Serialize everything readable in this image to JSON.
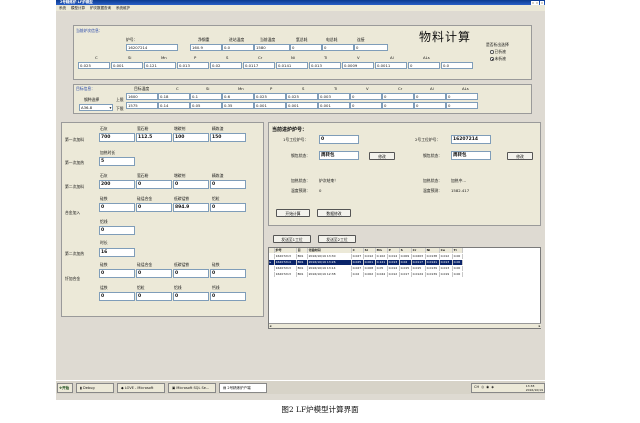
{
  "window": {
    "title": "2号精炼炉 LF炉模型",
    "menu": [
      "系统",
      "模型计算",
      "炉次数据查询",
      "系统维护"
    ]
  },
  "current": {
    "group_title": "当前炉次信息：",
    "heat_label": "炉号：",
    "heat_value": "16207214",
    "cols": [
      "净钢重",
      "进站温度",
      "当前温度",
      "氩总耗",
      "电总耗",
      "连接"
    ],
    "vals": [
      "160.9",
      "0.0",
      "1580",
      "0",
      "0",
      "0"
    ],
    "chem_labels": [
      "C",
      "Si",
      "Mn",
      "P",
      "S",
      "Cr",
      "Ni",
      "Ti",
      "V",
      "Al",
      "ALs"
    ],
    "chem_vals": [
      "0.025",
      "0.001",
      "0.121",
      "0.013",
      "0.02",
      "0.0117",
      "0.0141",
      "0.013",
      "0.0009",
      "0.0011",
      "0",
      "0.0"
    ]
  },
  "big_title": "物料计算",
  "alloyed": {
    "question": "是否析出选择",
    "options": [
      "已析液",
      "未析液"
    ],
    "selected": 1
  },
  "target": {
    "group_title": "目标信息：",
    "grade_label": "钢种选择",
    "grade_value": "A36-8",
    "upper_label": "上限",
    "lower_label": "下限",
    "headers": [
      "目标温度",
      "C",
      "Si",
      "Mn",
      "P",
      "S",
      "Ti",
      "V",
      "Cr",
      "Al",
      "ALs"
    ],
    "upper": [
      "1600",
      "0.18",
      "0.1",
      "0.6",
      "0.025",
      "0.025",
      "0.003",
      "0",
      "0",
      "0",
      "0"
    ],
    "lower": [
      "1575",
      "0.14",
      "0.05",
      "0.35",
      "0.001",
      "0.001",
      "0.001",
      "0",
      "0",
      "0",
      "0"
    ]
  },
  "additions": {
    "first_label": "第一次加料",
    "first_headers": [
      "石灰",
      "萤石粉",
      "增碳剂",
      "精炼渣"
    ],
    "first_vals": [
      "700",
      "112.5",
      "100",
      "150"
    ],
    "time_label": "加热时长",
    "first_time_label": "第一次加热",
    "first_time_val": "5",
    "second_label": "第二次加料",
    "second_headers": [
      "石灰",
      "萤石粉",
      "增碳剂",
      "精炼渣"
    ],
    "second_vals": [
      "200",
      "0",
      "0",
      "0"
    ],
    "alloy_label": "合金加入",
    "alloy_headers": [
      "硅铁",
      "硅锰合金",
      "低碳锰铁",
      "铝粒"
    ],
    "alloy_vals": [
      "0",
      "0",
      "894.9",
      "0"
    ],
    "wire_label": "铝线",
    "wire_val": "0",
    "second_time_header": "时长",
    "second_time_label": "第二次加热",
    "second_time_val": "16",
    "fine_label": "钎加合金",
    "fine_headers": [
      "硅铁",
      "硅锰合金",
      "低碳锰铁",
      "硅铁"
    ],
    "fine_vals": [
      "0",
      "0",
      "0",
      "0"
    ],
    "fine_headers2": [
      "锰铁",
      "铝粒",
      "铝线",
      "钙线"
    ],
    "fine_vals2": [
      "0",
      "0",
      "0",
      "0"
    ]
  },
  "station": {
    "title": "当前进炉炉号：",
    "s1_label": "1号工位炉号：",
    "s1_val": "0",
    "s2_label": "2号工位炉号：",
    "s2_val": "16207214",
    "state_label": "钢包状态：",
    "s1_state": "周转包",
    "s2_state": "周转包",
    "edit": "修改",
    "heat1_label": "加热状态：",
    "heat1_val": "炉次结束！",
    "heat2_label": "加热状态：",
    "heat2_val": "加热中...",
    "temp1_label": "温度预测：",
    "temp1_val": "0",
    "temp2_label": "温度预测：",
    "temp2_val": "1582.417",
    "start_btn": "开始计算",
    "data_btn": "数据修改",
    "send1": "发送至1工位",
    "send2": "发送至2工位"
  },
  "table": {
    "headers": [
      "",
      "炉号",
      "目",
      "化验时间",
      "C",
      "Si",
      "Mn",
      "P",
      "S",
      "Cr",
      "Ni",
      "Cu",
      "Ti"
    ],
    "rows": [
      [
        "",
        "16207213",
        "B01",
        "2016/10/19 13:30",
        "0.027",
        "0.012",
        "0.102",
        "0.014",
        "0.009",
        "0.0203",
        "0.0138",
        "0.012",
        "0.00"
      ],
      [
        "▸",
        "16207214",
        "B01",
        "2016/10/19 13:26",
        "0.025",
        "0.001",
        "0.121",
        "0.013",
        "0.02",
        "0.0117",
        "0.0141",
        "0.013",
        "0.00"
      ],
      [
        "",
        "16207213",
        "B01",
        "2016/10/19 13:14",
        "0.027",
        "0.008",
        "0.05",
        "0.014",
        "0.015",
        "0.015",
        "0.0139",
        "0.013",
        "0.00"
      ],
      [
        "",
        "16207213",
        "B01",
        "2016/10/19 12:38",
        "0.02",
        "0.002",
        "0.044",
        "0.012",
        "0.017",
        "0.0124",
        "0.0139",
        "0.019",
        "0.00"
      ]
    ]
  },
  "taskbar": {
    "start": "开始",
    "items": [
      "Debug",
      "LOVE - Microsoft",
      "Microsoft SQL Se...",
      "2号精炼炉户端"
    ],
    "tray_left": "CH",
    "clock_time": "13:38",
    "clock_date": "2016/10/19"
  },
  "caption": "图2 LF炉模型计算界面"
}
